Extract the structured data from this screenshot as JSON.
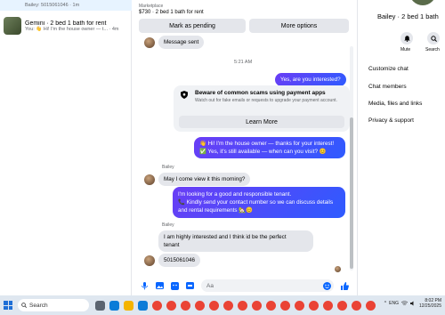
{
  "left": {
    "conversations": [
      {
        "name": "",
        "preview": "Bailey: 5015061046 · 1m",
        "selected": true
      },
      {
        "name": "Gemini · 2 bed 1 bath for rent",
        "preview": "You: 👋 Hi! I'm the house owner — t... · 4m",
        "selected": false
      }
    ]
  },
  "header": {
    "source": "Marketplace",
    "title": "$730 · 2 bed 1 bath for rent",
    "mark_pending": "Mark as pending",
    "more_options": "More options"
  },
  "thread": {
    "msg_sent": "Message sent",
    "timestamp": "5:21 AM",
    "out1": "Yes, are you interested?",
    "scam_title": "Beware of common scams using payment apps",
    "scam_desc": "Watch out for fake emails or requests to upgrade your payment account.",
    "learn_more": "Learn More",
    "out2_line1": "👋 Hi! I'm the house owner — thanks for your interest!",
    "out2_line2": "✅ Yes, it's still available — when can you visit? 😊",
    "sender1": "Bailey",
    "in1": "May I come view it this morning?",
    "out3_line1": "I'm looking for a good and responsible tenant.",
    "out3_line2": "📞 Kindly send your contact number so we can discuss details",
    "out3_line3": "and rental requirements 🏡😊",
    "sender2": "Bailey",
    "in2_line1": "I am highly interested and I think id be the perfect",
    "in2_line2": "tenant",
    "in3": "5015061046"
  },
  "composer": {
    "placeholder": "Aa"
  },
  "right": {
    "name": "Bailey · 2 bed 1 bath",
    "mute": "Mute",
    "search": "Search",
    "items": [
      "Customize chat",
      "Chat members",
      "Media, files and links",
      "Privacy & support"
    ]
  },
  "taskbar": {
    "search": "Search",
    "lang": "ENG",
    "time": "8:02 PM",
    "date": "12/25/2025"
  },
  "colors": {
    "accent": "#0866ff",
    "outgoing_start": "#6a3df5",
    "outgoing_end": "#2e5bff"
  }
}
